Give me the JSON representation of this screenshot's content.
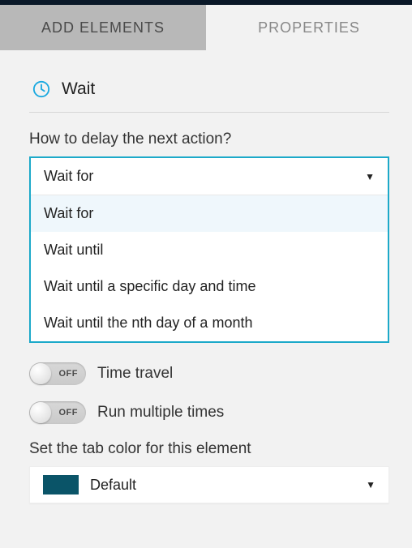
{
  "tabs": {
    "add_elements": "ADD ELEMENTS",
    "properties": "PROPERTIES"
  },
  "header": {
    "title": "Wait"
  },
  "delay": {
    "label": "How to delay the next action?",
    "selected": "Wait for",
    "options": [
      "Wait for",
      "Wait until",
      "Wait until a specific day and time",
      "Wait until the nth day of a month"
    ]
  },
  "toggles": {
    "off": "OFF",
    "time_travel": "Time travel",
    "run_multiple": "Run multiple times"
  },
  "color": {
    "label": "Set the tab color for this element",
    "name": "Default",
    "hex": "#0a5468"
  }
}
